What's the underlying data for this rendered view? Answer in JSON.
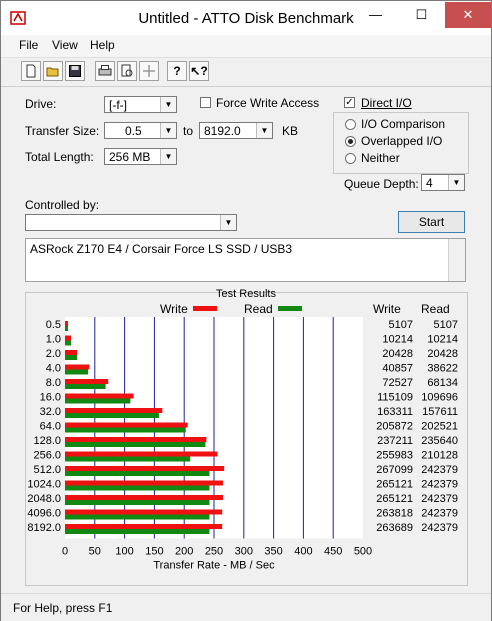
{
  "window": {
    "title": "Untitled - ATTO Disk Benchmark",
    "minimize_glyph": "—",
    "maximize_glyph": "☐",
    "close_glyph": "✕"
  },
  "menu": {
    "items": [
      "File",
      "View",
      "Help"
    ]
  },
  "toolbar": {
    "icons": [
      "new-file-icon",
      "open-folder-icon",
      "save-icon",
      "print-icon",
      "print-preview-icon",
      "move-icon",
      "help-icon",
      "context-help-icon"
    ]
  },
  "form": {
    "drive_label": "Drive:",
    "drive_value": "[-f-]",
    "force_write_label": "Force Write Access",
    "force_write_checked": false,
    "direct_io_label": "Direct I/O",
    "direct_io_checked": true,
    "transfer_size_label": "Transfer Size:",
    "transfer_from": "0.5",
    "to_label": "to",
    "transfer_to": "8192.0",
    "kb_label": "KB",
    "total_length_label": "Total Length:",
    "total_length_value": "256 MB",
    "io_comparison_label": "I/O Comparison",
    "overlapped_io_label": "Overlapped I/O",
    "neither_label": "Neither",
    "selected_io_mode": "Overlapped I/O",
    "queue_depth_label": "Queue Depth:",
    "queue_depth_value": "4",
    "controlled_by_label": "Controlled by:",
    "controlled_by_value": "",
    "start_label": "Start",
    "description": "ASRock Z170 E4 / Corsair Force LS SSD / USB3"
  },
  "results": {
    "title": "Test Results",
    "write_legend": "Write",
    "read_legend": "Read",
    "write_col_header": "Write",
    "read_col_header": "Read",
    "write_color": "#ee1111",
    "read_color": "#118811",
    "gridline_color": "#2020a0"
  },
  "chart_data": {
    "type": "bar",
    "orientation": "horizontal",
    "title": "Test Results",
    "xlabel": "Transfer Rate - MB / Sec",
    "xlim": [
      0,
      500
    ],
    "xticks": [
      0,
      50,
      100,
      150,
      200,
      250,
      300,
      350,
      400,
      450,
      500
    ],
    "categories": [
      "0.5",
      "1.0",
      "2.0",
      "4.0",
      "8.0",
      "16.0",
      "32.0",
      "64.0",
      "128.0",
      "256.0",
      "512.0",
      "1024.0",
      "2048.0",
      "4096.0",
      "8192.0"
    ],
    "series": [
      {
        "name": "Write",
        "values": [
          5107,
          10214,
          20428,
          40857,
          72527,
          115109,
          163311,
          205872,
          237211,
          255983,
          267099,
          265121,
          265121,
          263818,
          263689
        ]
      },
      {
        "name": "Read",
        "values": [
          5107,
          10214,
          20428,
          38622,
          68134,
          109696,
          157611,
          202521,
          235640,
          210128,
          242379,
          242379,
          242379,
          242379,
          242379
        ]
      }
    ],
    "value_scale_note_units": "KB/s table values; bars in MB/s",
    "grid": true,
    "legend": "top"
  },
  "status": {
    "text": "For Help, press F1"
  }
}
